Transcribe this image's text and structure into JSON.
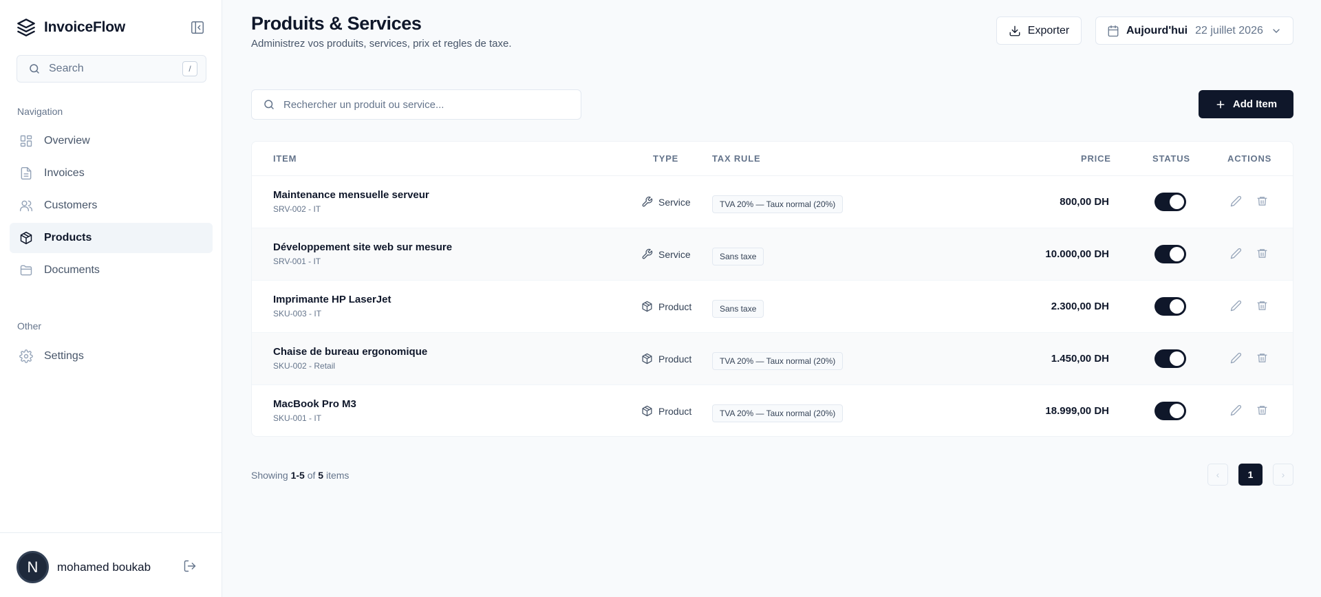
{
  "app": {
    "name": "InvoiceFlow"
  },
  "sidebar": {
    "search_placeholder": "Search",
    "search_shortcut": "/",
    "nav_label": "Navigation",
    "items": [
      {
        "label": "Overview",
        "icon": "grid-icon"
      },
      {
        "label": "Invoices",
        "icon": "file-icon"
      },
      {
        "label": "Customers",
        "icon": "users-icon"
      },
      {
        "label": "Products",
        "icon": "box-icon",
        "active": true
      },
      {
        "label": "Documents",
        "icon": "folder-icon"
      }
    ],
    "other_label": "Other",
    "other_items": [
      {
        "label": "Settings",
        "icon": "gear-icon"
      }
    ],
    "user": {
      "initial": "N",
      "name": "mohamed boukab"
    }
  },
  "header": {
    "title": "Produits & Services",
    "subtitle": "Administrez vos produits, services, prix et regles de taxe.",
    "export_label": "Exporter",
    "date_label": "Aujourd'hui",
    "date_value": "22 juillet 2026"
  },
  "toolbar": {
    "search_placeholder": "Rechercher un produit ou service...",
    "add_label": "Add Item"
  },
  "table": {
    "columns": [
      "ITEM",
      "TYPE",
      "TAX RULE",
      "PRICE",
      "STATUS",
      "ACTIONS"
    ],
    "rows": [
      {
        "name": "Maintenance mensuelle serveur",
        "sku": "SRV-002 - IT",
        "type": "Service",
        "tax": "TVA 20% — Taux normal (20%)",
        "price": "800,00 DH",
        "active": true
      },
      {
        "name": "Développement site web sur mesure",
        "sku": "SRV-001 - IT",
        "type": "Service",
        "tax": "Sans taxe",
        "price": "10.000,00 DH",
        "active": true
      },
      {
        "name": "Imprimante HP LaserJet",
        "sku": "SKU-003 - IT",
        "type": "Product",
        "tax": "Sans taxe",
        "price": "2.300,00 DH",
        "active": true
      },
      {
        "name": "Chaise de bureau ergonomique",
        "sku": "SKU-002 - Retail",
        "type": "Product",
        "tax": "TVA 20% — Taux normal (20%)",
        "price": "1.450,00 DH",
        "active": true
      },
      {
        "name": "MacBook Pro M3",
        "sku": "SKU-001 - IT",
        "type": "Product",
        "tax": "TVA 20% — Taux normal (20%)",
        "price": "18.999,00 DH",
        "active": true
      }
    ]
  },
  "footer": {
    "showing_prefix": "Showing",
    "range": "1-5",
    "of": "of",
    "total": "5",
    "items_word": "items",
    "current_page": "1",
    "prev_symbol": "‹",
    "next_symbol": "›"
  },
  "colors": {
    "primary": "#0f172a",
    "muted": "#64748b",
    "border": "#e2e8f0",
    "background": "#f8fafc"
  }
}
